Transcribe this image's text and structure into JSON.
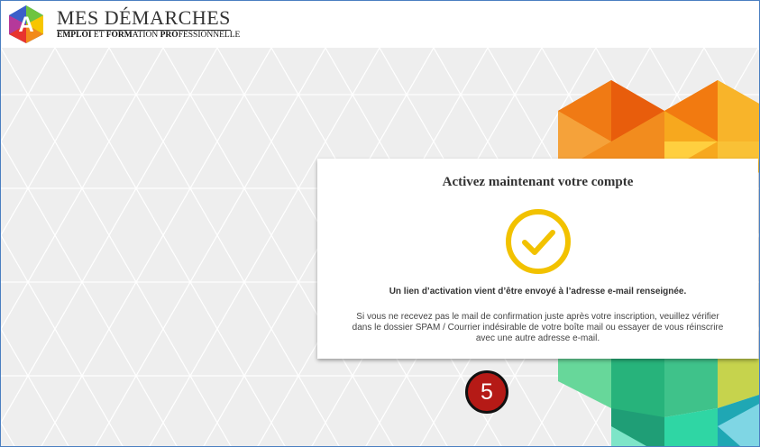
{
  "brand": {
    "logo_letter": "A",
    "title": "MES DÉMARCHES",
    "subtitle_parts": [
      "EMPLOI",
      " ET ",
      "FORM",
      "ATION ",
      "PRO",
      "FESSIONNELLE"
    ]
  },
  "card": {
    "title": "Activez maintenant votre compte",
    "lead": "Un lien d’activation vient d’être envoyé à l’adresse e-mail renseignée.",
    "note_lines": [
      "Si vous ne recevez pas le mail de confirmation juste après votre inscription, veuillez vérifier",
      "dans le dossier SPAM / Courrier indésirable de votre boîte mail ou essayer de vous réinscrire",
      "avec une autre adresse e-mail."
    ],
    "icon": "check-circle-icon"
  },
  "step_badge": "5",
  "colors": {
    "frame_border": "#4a7fc1",
    "check_yellow": "#f2c200",
    "badge_red": "#b51a16",
    "background_gray": "#eeeeee"
  }
}
